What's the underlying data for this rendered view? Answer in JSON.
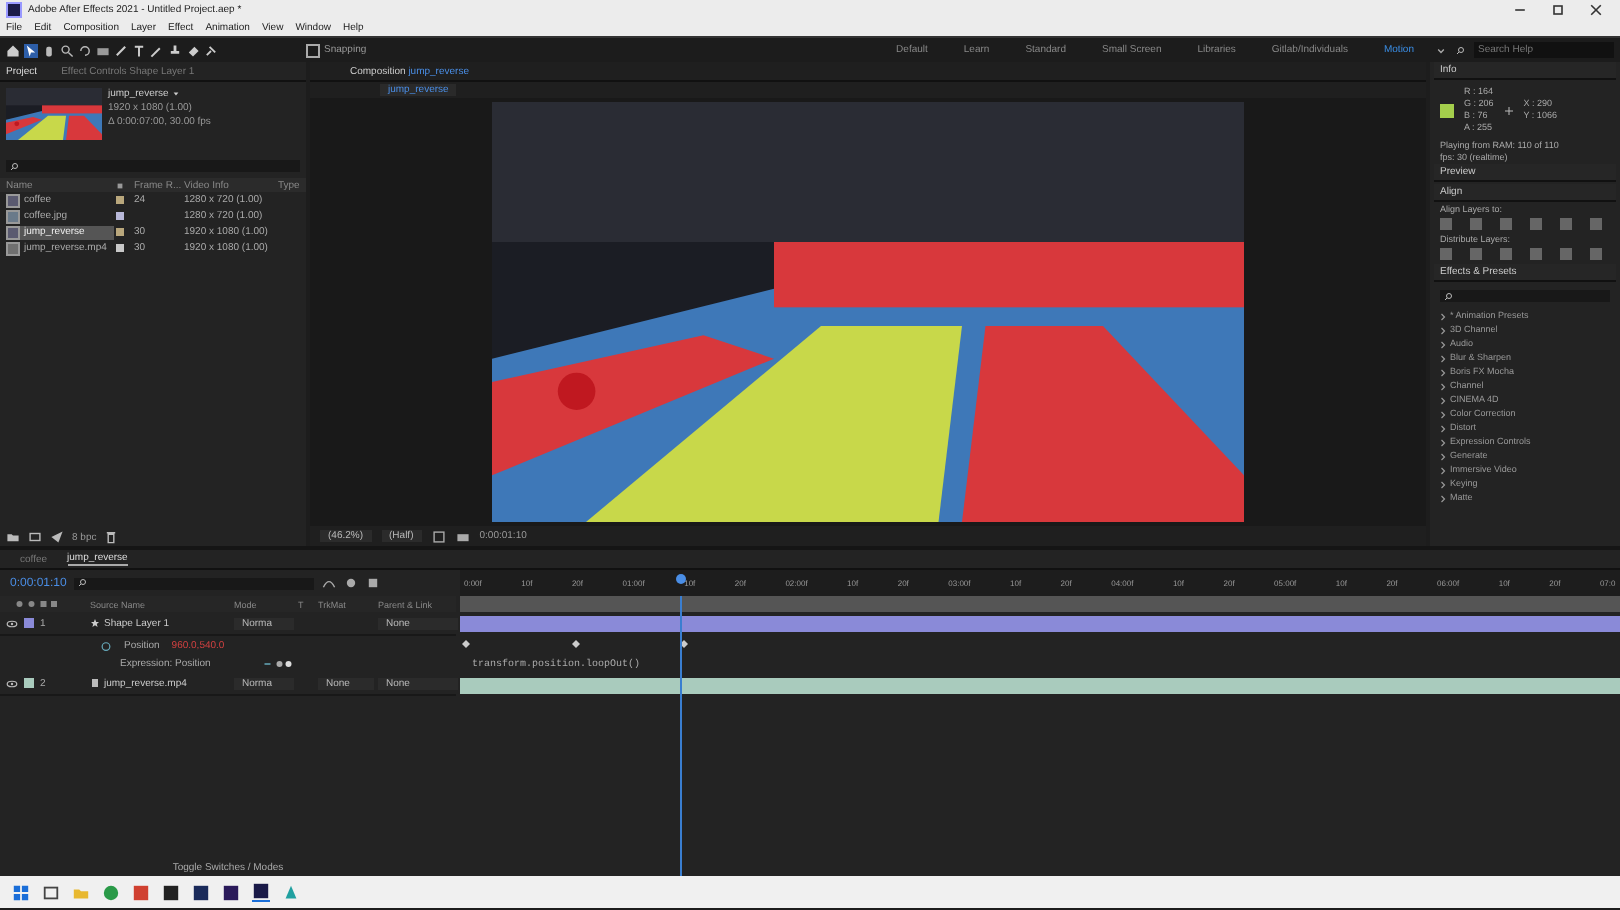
{
  "window": {
    "title": "Adobe After Effects 2021 - Untitled Project.aep *"
  },
  "menu": [
    "File",
    "Edit",
    "Composition",
    "Layer",
    "Effect",
    "Animation",
    "View",
    "Window",
    "Help"
  ],
  "toolbar": {
    "snapping": {
      "label": "Snapping",
      "checked": false
    },
    "workspaces": [
      {
        "label": "Default",
        "selected": false
      },
      {
        "label": "Learn",
        "selected": false
      },
      {
        "label": "Standard",
        "selected": false
      },
      {
        "label": "Small Screen",
        "selected": false
      },
      {
        "label": "Libraries",
        "selected": false
      },
      {
        "label": "Gitlab/Individuals",
        "selected": false
      },
      {
        "label": "Motion",
        "selected": true
      }
    ],
    "search": {
      "placeholder": "Search Help"
    }
  },
  "project": {
    "tabs": [
      {
        "label": "Project",
        "selected": true
      },
      {
        "label": "Effect Controls Shape Layer 1",
        "selected": false
      }
    ],
    "preview_name": "jump_reverse",
    "preview_lines": [
      "1920 x 1080 (1.00)",
      "Δ 0:00:07:00, 30.00 fps"
    ],
    "columns": [
      "Name",
      "Frame R...",
      "Video Info",
      "Type"
    ],
    "items": [
      {
        "kind": "comp",
        "name": "coffee",
        "frame_rate": "24",
        "video_info": "1280 x 720 (1.00)",
        "color": "#b9a77c",
        "selected": false
      },
      {
        "kind": "image",
        "name": "coffee.jpg",
        "video_info": "1280 x 720 (1.00)",
        "color": "#b8b8d8",
        "selected": false
      },
      {
        "kind": "comp",
        "name": "jump_reverse",
        "frame_rate": "30",
        "video_info": "1920 x 1080 (1.00)",
        "color": "#b9a77c",
        "selected": true
      },
      {
        "kind": "footage",
        "name": "jump_reverse.mp4",
        "frame_rate": "30",
        "video_info": "1920 x 1080 (1.00)",
        "color": "#c8c8c8",
        "selected": false
      }
    ],
    "bpc": "8 bpc"
  },
  "composition": {
    "tab": "Composition",
    "name": "jump_reverse",
    "breadcrumb": "jump_reverse",
    "zoom": "(46.2%)",
    "resolution": "(Half)",
    "time": "0:00:01:10"
  },
  "info": {
    "title": "Info",
    "channels": [
      "R : 164",
      "G : 206",
      "B : 76",
      "A : 255"
    ],
    "coords": [
      "X : 290",
      "Y : 1066"
    ],
    "status": [
      "Playing from RAM: 110 of 110",
      "fps: 30 (realtime)"
    ]
  },
  "preview": {
    "title": "Preview"
  },
  "align": {
    "title": "Align",
    "align_to": "Align Layers to:",
    "distribute": "Distribute Layers:"
  },
  "effects": {
    "title": "Effects & Presets",
    "items": [
      "* Animation Presets",
      "3D Channel",
      "Audio",
      "Blur & Sharpen",
      "Boris FX Mocha",
      "Channel",
      "CINEMA 4D",
      "Color Correction",
      "Distort",
      "Expression Controls",
      "Generate",
      "Immersive Video",
      "Keying",
      "Matte"
    ]
  },
  "timeline": {
    "tabs": [
      {
        "label": "coffee",
        "selected": false
      },
      {
        "label": "jump_reverse",
        "selected": true
      }
    ],
    "time": "0:00:01:10",
    "columns": [
      "Source Name",
      "Mode",
      "T",
      "TrkMat",
      "Parent & Link"
    ],
    "ruler": [
      "0:00f",
      "10f",
      "20f",
      "01:00f",
      "10f",
      "20f",
      "02:00f",
      "10f",
      "20f",
      "03:00f",
      "10f",
      "20f",
      "04:00f",
      "10f",
      "20f",
      "05:00f",
      "10f",
      "20f",
      "06:00f",
      "10f",
      "20f",
      "07:0"
    ],
    "playhead": {
      "level": 0.19
    },
    "layers": [
      {
        "index": "1",
        "kind": "shape",
        "name": "Shape Layer 1",
        "mode": "Norma",
        "parent": "None",
        "color": "#8a8ad8",
        "property": {
          "name": "Position",
          "value": "960.0,540.0",
          "expression_label": "Expression: Position",
          "expression": "transform.position.loopOut()"
        }
      },
      {
        "index": "2",
        "kind": "footage",
        "name": "jump_reverse.mp4",
        "mode": "Norma",
        "trkmat": "None",
        "parent": "None",
        "color": "#a9cbbd"
      }
    ],
    "footer": "Toggle Switches / Modes"
  }
}
